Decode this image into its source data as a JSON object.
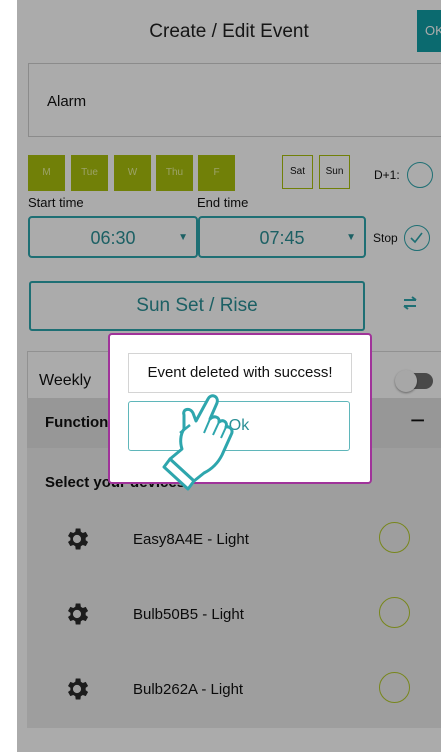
{
  "header": {
    "title": "Create / Edit Event",
    "ok_label": "OK"
  },
  "event_name": "Alarm",
  "days": {
    "weekdays": [
      "M",
      "Tue",
      "W",
      "Thu",
      "F"
    ],
    "weekend": [
      "Sat",
      "Sun"
    ],
    "next_day_label": "D+1:"
  },
  "times": {
    "start_label": "Start time",
    "end_label": "End time",
    "start_value": "06:30",
    "end_value": "07:45",
    "stop_label": "Stop"
  },
  "sun_button_label": "Sun Set / Rise",
  "repeat_label": "Weekly",
  "functions": {
    "title": "Functions",
    "collapse_symbol": "−",
    "select_devices_label": "Select your devices",
    "devices": [
      "Easy8A4E - Light",
      "Bulb50B5 - Light",
      "Bulb262A - Light"
    ]
  },
  "dialog": {
    "message": "Event deleted with success!",
    "ok_label": "Ok"
  },
  "colors": {
    "accent": "#2ea6ad",
    "day_selected": "#a9bf0c",
    "dialog_border": "#a0339a"
  }
}
